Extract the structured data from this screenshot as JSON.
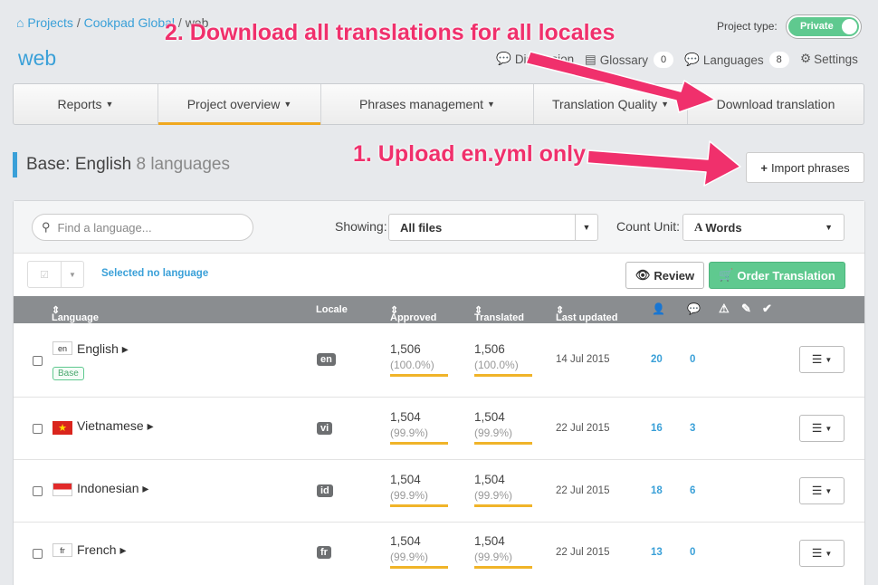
{
  "breadcrumb": {
    "projects": "Projects",
    "org": "Cookpad Global",
    "current": "web"
  },
  "project_name": "web",
  "project_type": {
    "label": "Project type:",
    "value": "Private"
  },
  "toplinks": {
    "discussion": "Discussion",
    "glossary": "Glossary",
    "glossary_count": "0",
    "languages": "Languages",
    "languages_count": "8",
    "settings": "Settings"
  },
  "tabs": [
    "Reports",
    "Project overview",
    "Phrases management",
    "Translation Quality",
    "Download translation"
  ],
  "section": {
    "title": "Base: English",
    "subtitle": "8 languages",
    "import_label": "Import phrases"
  },
  "toolbar": {
    "search_placeholder": "Find a language...",
    "showing_label": "Showing:",
    "showing_value": "All files",
    "count_label": "Count Unit:",
    "count_value": "Words",
    "selected_text": "Selected no language",
    "review_label": "Review",
    "order_label": "Order Translation"
  },
  "columns": {
    "language": "Language",
    "locale": "Locale",
    "approved": "Approved",
    "translated": "Translated",
    "last_updated": "Last updated"
  },
  "rows": [
    {
      "name": "English",
      "flag": "en",
      "locale": "en",
      "approved": "1,506",
      "approved_pct": "(100.0%)",
      "translated": "1,506",
      "translated_pct": "(100.0%)",
      "updated": "14 Jul 2015",
      "users": "20",
      "comments": "0",
      "badge": "Base"
    },
    {
      "name": "Vietnamese",
      "flag": "vn",
      "locale": "vi",
      "approved": "1,504",
      "approved_pct": "(99.9%)",
      "translated": "1,504",
      "translated_pct": "(99.9%)",
      "updated": "22 Jul 2015",
      "users": "16",
      "comments": "3"
    },
    {
      "name": "Indonesian",
      "flag": "id",
      "locale": "id",
      "approved": "1,504",
      "approved_pct": "(99.9%)",
      "translated": "1,504",
      "translated_pct": "(99.9%)",
      "updated": "22 Jul 2015",
      "users": "18",
      "comments": "6"
    },
    {
      "name": "French",
      "flag": "fr",
      "locale": "fr",
      "approved": "1,504",
      "approved_pct": "(99.9%)",
      "translated": "1,504",
      "translated_pct": "(99.9%)",
      "updated": "22 Jul 2015",
      "users": "13",
      "comments": "0"
    }
  ],
  "annotations": {
    "download": "2. Download all translations for all locales",
    "upload": "1. Upload en.yml only"
  },
  "colors": {
    "accent": "#3aa0d8",
    "green": "#5fc98f",
    "tab_active": "#f0a81f",
    "annotation": "#f0306c"
  }
}
